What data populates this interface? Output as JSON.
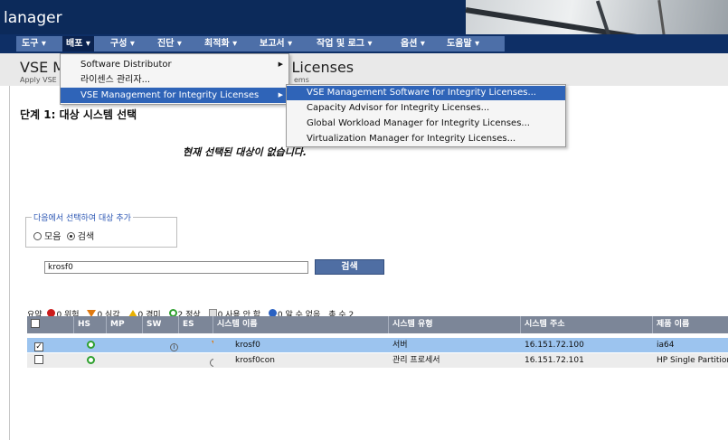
{
  "app": {
    "title": "lanager"
  },
  "menu": {
    "items": [
      {
        "label": "도구 ▾"
      },
      {
        "label": "배포 ▾"
      },
      {
        "label": "구성 ▾"
      },
      {
        "label": "진단 ▾"
      },
      {
        "label": "최적화 ▾"
      },
      {
        "label": "보고서 ▾"
      },
      {
        "label": "작업 및 로그 ▾"
      },
      {
        "label": "옵션 ▾"
      },
      {
        "label": "도움말 ▾"
      }
    ]
  },
  "header": {
    "title_left": "VSE M",
    "title_right": "/ Licenses",
    "subtitle_left": "Apply VSE",
    "subtitle_right": "ems"
  },
  "dropdown": {
    "items": [
      {
        "label": "Software Distributor",
        "arrow": "▶"
      },
      {
        "label": "라이센스 관리자...",
        "arrow": ""
      },
      {
        "label": "VSE Management for Integrity Licenses",
        "arrow": "▶"
      }
    ]
  },
  "submenu": {
    "items": [
      {
        "label": "VSE Management Software for Integrity Licenses..."
      },
      {
        "label": "Capacity Advisor for Integrity Licenses..."
      },
      {
        "label": "Global Workload Manager for Integrity Licenses..."
      },
      {
        "label": "Virtualization Manager for Integrity Licenses..."
      }
    ]
  },
  "step": {
    "title": "단계 1: 대상 시스템 선택"
  },
  "selected_target_text": "현재 선택된 대상이 없습니다.",
  "add_target": {
    "legend": "다음에서 선택하여 대상 추가",
    "options": [
      {
        "label": "모음",
        "selected": false
      },
      {
        "label": "검색",
        "selected": true
      }
    ]
  },
  "search": {
    "value": "krosf0",
    "button_label": "검색"
  },
  "summary": {
    "prefix": "요약",
    "crit": "0 위험",
    "major": "0 심각",
    "minor": "0 경미",
    "normal": "2 정상",
    "disabled": "0 사용 안 함",
    "unknown": "0 알 수 없음",
    "total": "총 수 2"
  },
  "table": {
    "headers": [
      "",
      "HS",
      "MP",
      "SW",
      "ES",
      "시스템 이름",
      "시스템 유형",
      "시스템 주소",
      "제품 이름"
    ],
    "rows": [
      {
        "checked": true,
        "name": "krosf0",
        "type": "서버",
        "address": "16.151.72.100",
        "product": "ia64"
      },
      {
        "checked": false,
        "name": "krosf0con",
        "type": "관리 프로세서",
        "address": "16.151.72.101",
        "product": "HP Single Partition Se..."
      }
    ]
  },
  "colors": {
    "banner": "#0c2a5a",
    "menu_bg": "#4d6fa8",
    "highlight": "#2f64b8",
    "table_head": "#7c8698",
    "row_selected": "#9cc4ef"
  }
}
